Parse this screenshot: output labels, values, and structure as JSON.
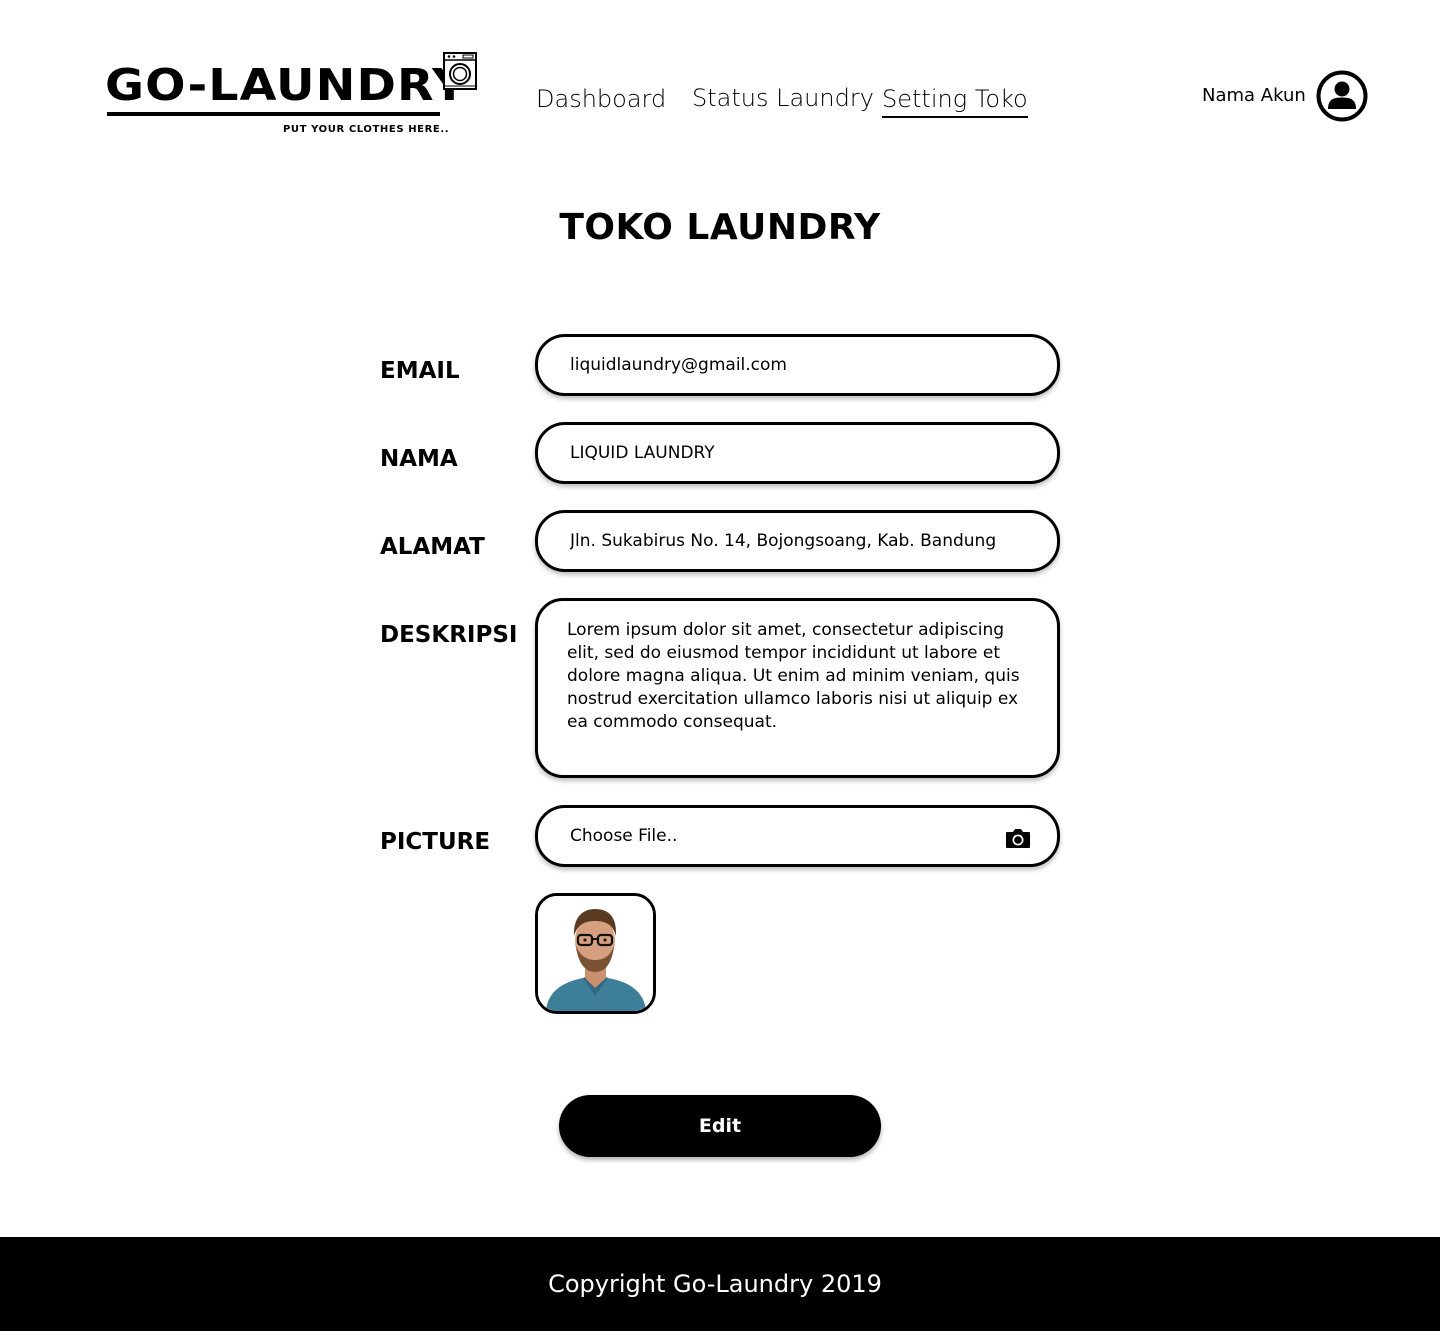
{
  "header": {
    "logo_text": "GO-LAUNDRY",
    "logo_tagline": "PUT YOUR CLOTHES HERE..",
    "nav": [
      {
        "label": "Dashboard"
      },
      {
        "label": "Status Laundry"
      },
      {
        "label": "Setting Toko",
        "active": true
      }
    ],
    "account_name": "Nama Akun",
    "account_icon": "user-circle-icon"
  },
  "page": {
    "title": "TOKO LAUNDRY"
  },
  "form": {
    "email": {
      "label": "EMAIL",
      "value": "liquidlaundry@gmail.com"
    },
    "nama": {
      "label": "NAMA",
      "value": "LIQUID LAUNDRY"
    },
    "alamat": {
      "label": "ALAMAT",
      "value": "Jln. Sukabirus No. 14, Bojongsoang, Kab. Bandung"
    },
    "deskripsi": {
      "label": "DESKRIPSI",
      "value": "Lorem ipsum dolor sit amet, consectetur adipiscing elit, sed do eiusmod tempor incididunt ut labore et dolore magna aliqua. Ut enim ad minim veniam, quis nostrud exercitation ullamco laboris nisi ut aliquip ex ea commodo consequat."
    },
    "picture": {
      "label": "PICTURE",
      "placeholder": "Choose File..",
      "icon": "camera-icon"
    },
    "edit_label": "Edit"
  },
  "footer": {
    "copyright": "Copyright Go-Laundry 2019"
  },
  "colors": {
    "primary": "#000000",
    "background": "#ffffff",
    "footer_text": "#ffffff"
  }
}
